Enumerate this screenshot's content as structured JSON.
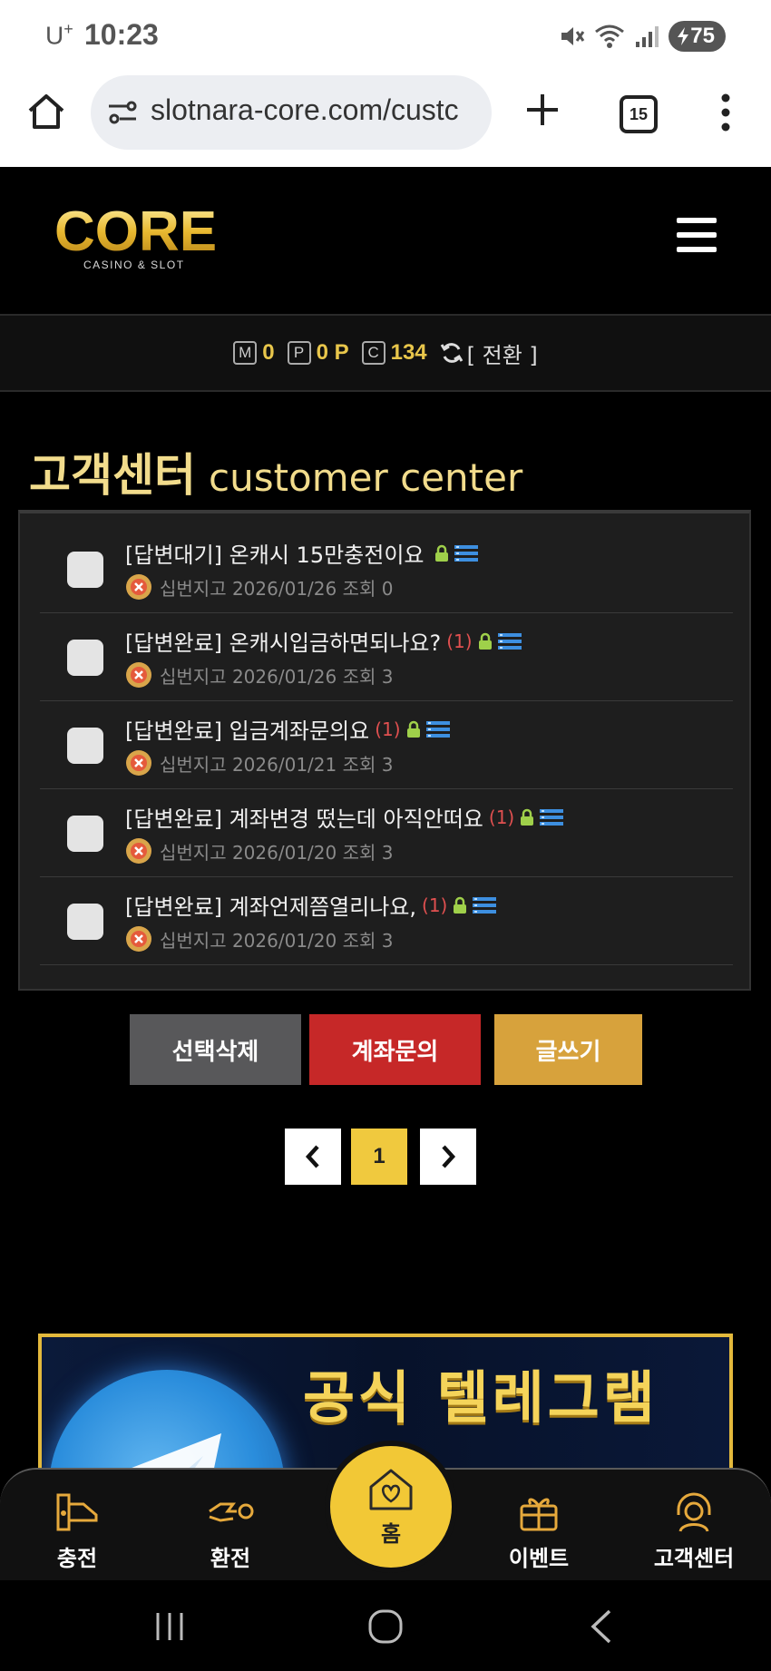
{
  "status_bar": {
    "carrier": "U",
    "carrier_sup": "+",
    "time": "10:23",
    "battery": "75"
  },
  "browser": {
    "url": "slotnara-core.com/custc",
    "tab_count": "15"
  },
  "site": {
    "logo_text": "CORE",
    "logo_sub": "CASINO & SLOT"
  },
  "points": {
    "m_label": "M",
    "m_value": "0",
    "p_label": "P",
    "p_value": "0 P",
    "c_label": "C",
    "c_value": "134",
    "switch_label": "[ 전환 ]"
  },
  "page": {
    "title_ko": "고객센터",
    "title_en": "customer center"
  },
  "inquiries": [
    {
      "title": "[답변대기] 온캐시 15만충전이요",
      "count": "",
      "meta": "십번지고 2026/01/26 조회 0"
    },
    {
      "title": "[답변완료] 온캐시입금하면되나요?",
      "count": "(1)",
      "meta": "십번지고 2026/01/26 조회 3"
    },
    {
      "title": "[답변완료] 입금계좌문의요",
      "count": "(1)",
      "meta": "십번지고 2026/01/21 조회 3"
    },
    {
      "title": "[답변완료] 계좌변경 떴는데 아직안떠요",
      "count": "(1)",
      "meta": "십번지고 2026/01/20 조회 3"
    },
    {
      "title": "[답변완료] 계좌언제쯤열리나요,",
      "count": "(1)",
      "meta": "십번지고 2026/01/20 조회 3"
    }
  ],
  "actions": {
    "delete_label": "선택삭제",
    "account_label": "계좌문의",
    "write_label": "글쓰기"
  },
  "pagination": {
    "current": "1"
  },
  "banner": {
    "text": "공식 텔레그램"
  },
  "bottom_nav": {
    "charge": "충전",
    "exchange": "환전",
    "home": "홈",
    "event": "이벤트",
    "support": "고객센터"
  },
  "colors": {
    "gold": "#f2dc8c",
    "delete_btn": "#58585a",
    "account_btn": "#c62828",
    "write_btn": "#d7a23c",
    "page_active": "#f0c93e",
    "reply_count": "#e05050"
  }
}
